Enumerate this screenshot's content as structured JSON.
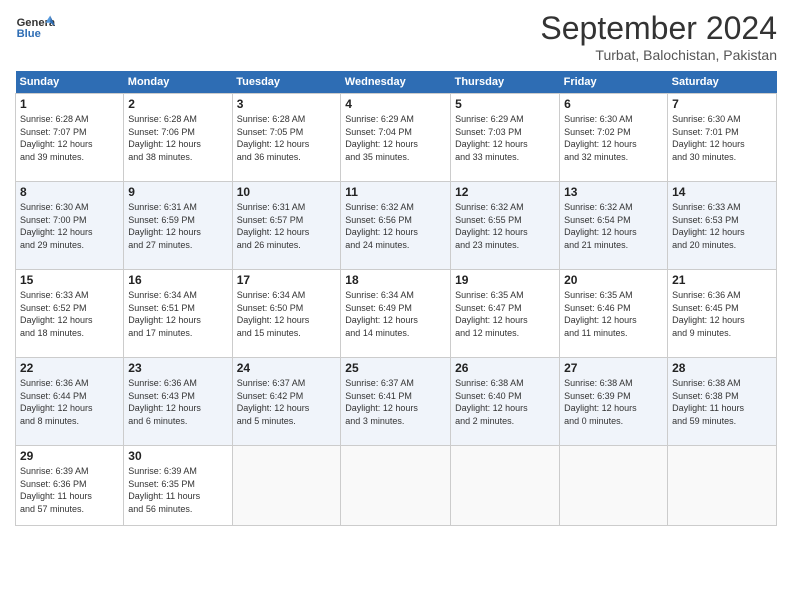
{
  "header": {
    "logo_text_general": "General",
    "logo_text_blue": "Blue",
    "month_title": "September 2024",
    "subtitle": "Turbat, Balochistan, Pakistan"
  },
  "days_of_week": [
    "Sunday",
    "Monday",
    "Tuesday",
    "Wednesday",
    "Thursday",
    "Friday",
    "Saturday"
  ],
  "weeks": [
    [
      {
        "day": "1",
        "sunrise": "6:28 AM",
        "sunset": "7:07 PM",
        "daylight": "12 hours and 39 minutes."
      },
      {
        "day": "2",
        "sunrise": "6:28 AM",
        "sunset": "7:06 PM",
        "daylight": "12 hours and 38 minutes."
      },
      {
        "day": "3",
        "sunrise": "6:28 AM",
        "sunset": "7:05 PM",
        "daylight": "12 hours and 36 minutes."
      },
      {
        "day": "4",
        "sunrise": "6:29 AM",
        "sunset": "7:04 PM",
        "daylight": "12 hours and 35 minutes."
      },
      {
        "day": "5",
        "sunrise": "6:29 AM",
        "sunset": "7:03 PM",
        "daylight": "12 hours and 33 minutes."
      },
      {
        "day": "6",
        "sunrise": "6:30 AM",
        "sunset": "7:02 PM",
        "daylight": "12 hours and 32 minutes."
      },
      {
        "day": "7",
        "sunrise": "6:30 AM",
        "sunset": "7:01 PM",
        "daylight": "12 hours and 30 minutes."
      }
    ],
    [
      {
        "day": "8",
        "sunrise": "6:30 AM",
        "sunset": "7:00 PM",
        "daylight": "12 hours and 29 minutes."
      },
      {
        "day": "9",
        "sunrise": "6:31 AM",
        "sunset": "6:59 PM",
        "daylight": "12 hours and 27 minutes."
      },
      {
        "day": "10",
        "sunrise": "6:31 AM",
        "sunset": "6:57 PM",
        "daylight": "12 hours and 26 minutes."
      },
      {
        "day": "11",
        "sunrise": "6:32 AM",
        "sunset": "6:56 PM",
        "daylight": "12 hours and 24 minutes."
      },
      {
        "day": "12",
        "sunrise": "6:32 AM",
        "sunset": "6:55 PM",
        "daylight": "12 hours and 23 minutes."
      },
      {
        "day": "13",
        "sunrise": "6:32 AM",
        "sunset": "6:54 PM",
        "daylight": "12 hours and 21 minutes."
      },
      {
        "day": "14",
        "sunrise": "6:33 AM",
        "sunset": "6:53 PM",
        "daylight": "12 hours and 20 minutes."
      }
    ],
    [
      {
        "day": "15",
        "sunrise": "6:33 AM",
        "sunset": "6:52 PM",
        "daylight": "12 hours and 18 minutes."
      },
      {
        "day": "16",
        "sunrise": "6:34 AM",
        "sunset": "6:51 PM",
        "daylight": "12 hours and 17 minutes."
      },
      {
        "day": "17",
        "sunrise": "6:34 AM",
        "sunset": "6:50 PM",
        "daylight": "12 hours and 15 minutes."
      },
      {
        "day": "18",
        "sunrise": "6:34 AM",
        "sunset": "6:49 PM",
        "daylight": "12 hours and 14 minutes."
      },
      {
        "day": "19",
        "sunrise": "6:35 AM",
        "sunset": "6:47 PM",
        "daylight": "12 hours and 12 minutes."
      },
      {
        "day": "20",
        "sunrise": "6:35 AM",
        "sunset": "6:46 PM",
        "daylight": "12 hours and 11 minutes."
      },
      {
        "day": "21",
        "sunrise": "6:36 AM",
        "sunset": "6:45 PM",
        "daylight": "12 hours and 9 minutes."
      }
    ],
    [
      {
        "day": "22",
        "sunrise": "6:36 AM",
        "sunset": "6:44 PM",
        "daylight": "12 hours and 8 minutes."
      },
      {
        "day": "23",
        "sunrise": "6:36 AM",
        "sunset": "6:43 PM",
        "daylight": "12 hours and 6 minutes."
      },
      {
        "day": "24",
        "sunrise": "6:37 AM",
        "sunset": "6:42 PM",
        "daylight": "12 hours and 5 minutes."
      },
      {
        "day": "25",
        "sunrise": "6:37 AM",
        "sunset": "6:41 PM",
        "daylight": "12 hours and 3 minutes."
      },
      {
        "day": "26",
        "sunrise": "6:38 AM",
        "sunset": "6:40 PM",
        "daylight": "12 hours and 2 minutes."
      },
      {
        "day": "27",
        "sunrise": "6:38 AM",
        "sunset": "6:39 PM",
        "daylight": "12 hours and 0 minutes."
      },
      {
        "day": "28",
        "sunrise": "6:38 AM",
        "sunset": "6:38 PM",
        "daylight": "11 hours and 59 minutes."
      }
    ],
    [
      {
        "day": "29",
        "sunrise": "6:39 AM",
        "sunset": "6:36 PM",
        "daylight": "11 hours and 57 minutes."
      },
      {
        "day": "30",
        "sunrise": "6:39 AM",
        "sunset": "6:35 PM",
        "daylight": "11 hours and 56 minutes."
      },
      null,
      null,
      null,
      null,
      null
    ]
  ],
  "labels": {
    "sunrise": "Sunrise:",
    "sunset": "Sunset:",
    "daylight": "Daylight:"
  }
}
